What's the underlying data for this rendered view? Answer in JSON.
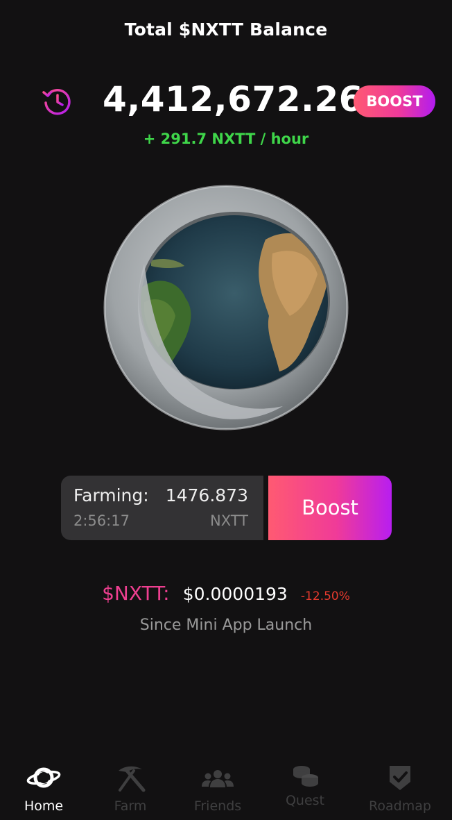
{
  "header": {
    "title": "Total $NXTT Balance",
    "balance": "4,412,672.262",
    "boost_label": "BOOST",
    "rate": "+ 291.7 NXTT / hour",
    "history_icon": "history-clock-icon"
  },
  "farming": {
    "label": "Farming:",
    "amount": "1476.873",
    "timer": "2:56:17",
    "unit": "NXTT",
    "boost_label": "Boost"
  },
  "price": {
    "label": "$NXTT:",
    "value": "$0.0000193",
    "change": "-12.50%",
    "since": "Since Mini App Launch"
  },
  "nav": {
    "items": [
      {
        "label": "Home",
        "icon": "planet-icon",
        "active": true
      },
      {
        "label": "Farm",
        "icon": "pickaxe-icon",
        "active": false
      },
      {
        "label": "Friends",
        "icon": "users-icon",
        "active": false
      },
      {
        "label": "Quest",
        "icon": "coins-icon",
        "active": false
      },
      {
        "label": "Roadmap",
        "icon": "shield-check-icon",
        "active": false
      }
    ]
  },
  "colors": {
    "background": "#121112",
    "accent_pink": "#ee3f90",
    "accent_purple": "#b21cf0",
    "positive": "#3fd64a",
    "negative": "#e63a2e"
  }
}
